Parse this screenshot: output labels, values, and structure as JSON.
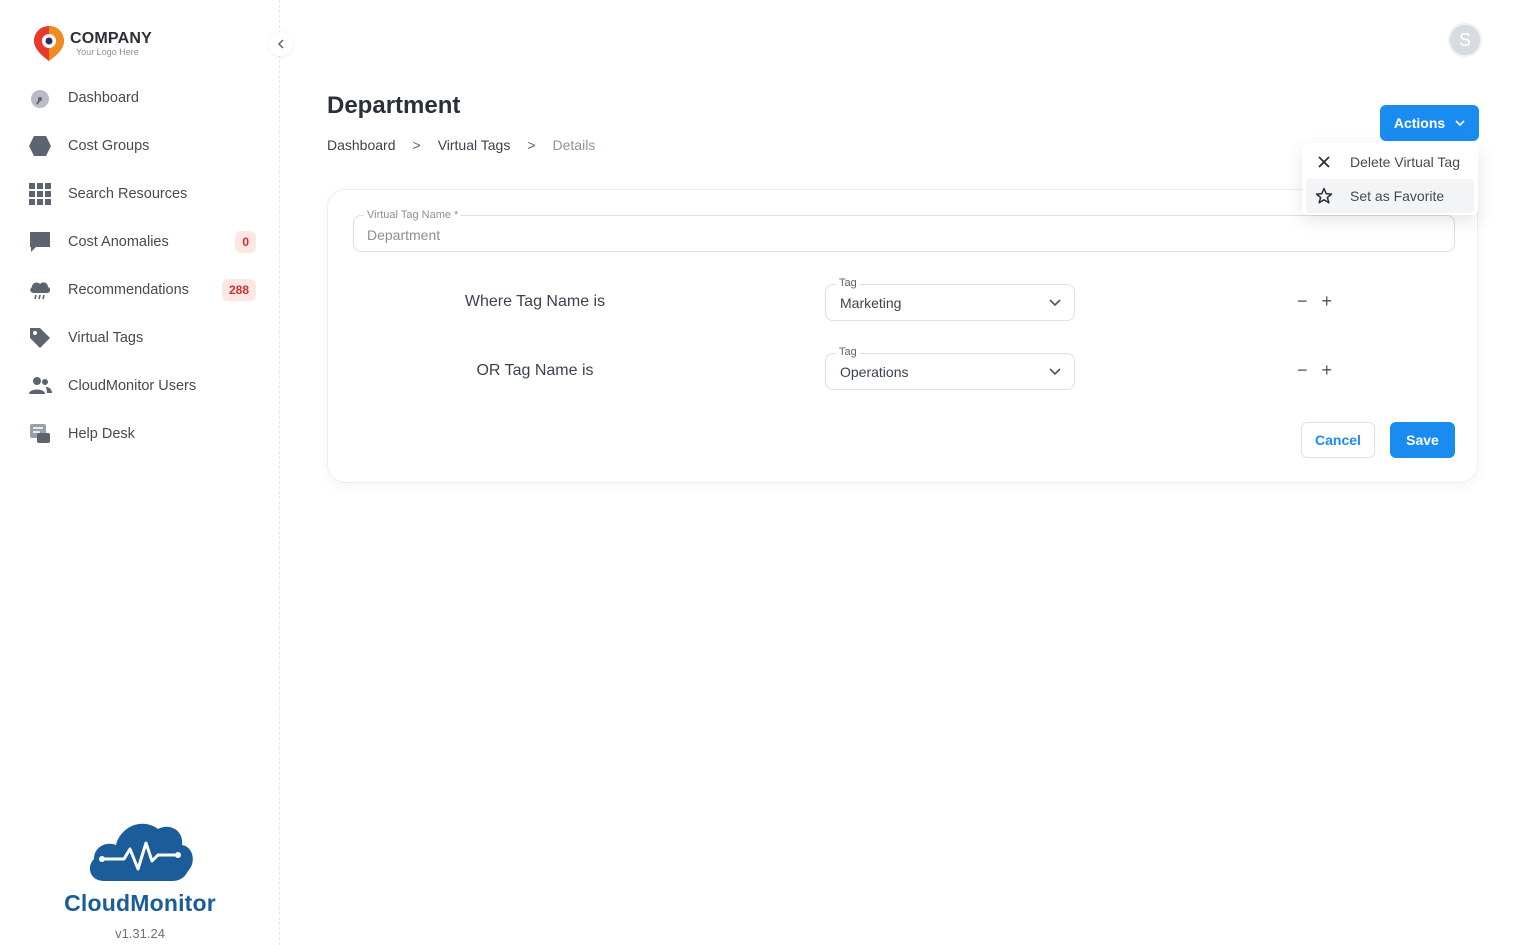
{
  "logo": {
    "title": "COMPANY",
    "subtitle": "Your Logo Here"
  },
  "sidebar": {
    "items": [
      {
        "label": "Dashboard",
        "icon": "dashboard-gauge-icon"
      },
      {
        "label": "Cost Groups",
        "icon": "hexagon-icon"
      },
      {
        "label": "Search Resources",
        "icon": "grid-icon"
      },
      {
        "label": "Cost Anomalies",
        "icon": "chat-bubble-icon",
        "badge": "0"
      },
      {
        "label": "Recommendations",
        "icon": "cloud-rain-icon",
        "badge": "288"
      },
      {
        "label": "Virtual Tags",
        "icon": "tag-icon"
      },
      {
        "label": "CloudMonitor Users",
        "icon": "users-icon"
      },
      {
        "label": "Help Desk",
        "icon": "help-desk-icon"
      }
    ],
    "brand_name": "CloudMonitor",
    "version": "v1.31.24"
  },
  "header": {
    "avatar_initial": "S"
  },
  "page": {
    "title": "Department",
    "breadcrumb": [
      "Dashboard",
      "Virtual Tags",
      "Details"
    ],
    "breadcrumb_separator": ">",
    "actions_label": "Actions"
  },
  "actions_menu": {
    "items": [
      {
        "label": "Delete Virtual Tag",
        "icon": "close-icon"
      },
      {
        "label": "Set as Favorite",
        "icon": "star-icon"
      }
    ]
  },
  "form": {
    "name_label": "Virtual Tag Name *",
    "name_value": "Department",
    "conditions": [
      {
        "label": "Where Tag Name is",
        "field_label": "Tag",
        "value": "Marketing"
      },
      {
        "label": "OR Tag Name is",
        "field_label": "Tag",
        "value": "Operations"
      }
    ],
    "stepper": {
      "minus": "−",
      "plus": "+"
    },
    "cancel_label": "Cancel",
    "save_label": "Save"
  },
  "colors": {
    "primary": "#1a8cf0",
    "brand": "#1b5d9a",
    "badge_bg": "#fde7e4",
    "badge_text": "#d0302a"
  }
}
